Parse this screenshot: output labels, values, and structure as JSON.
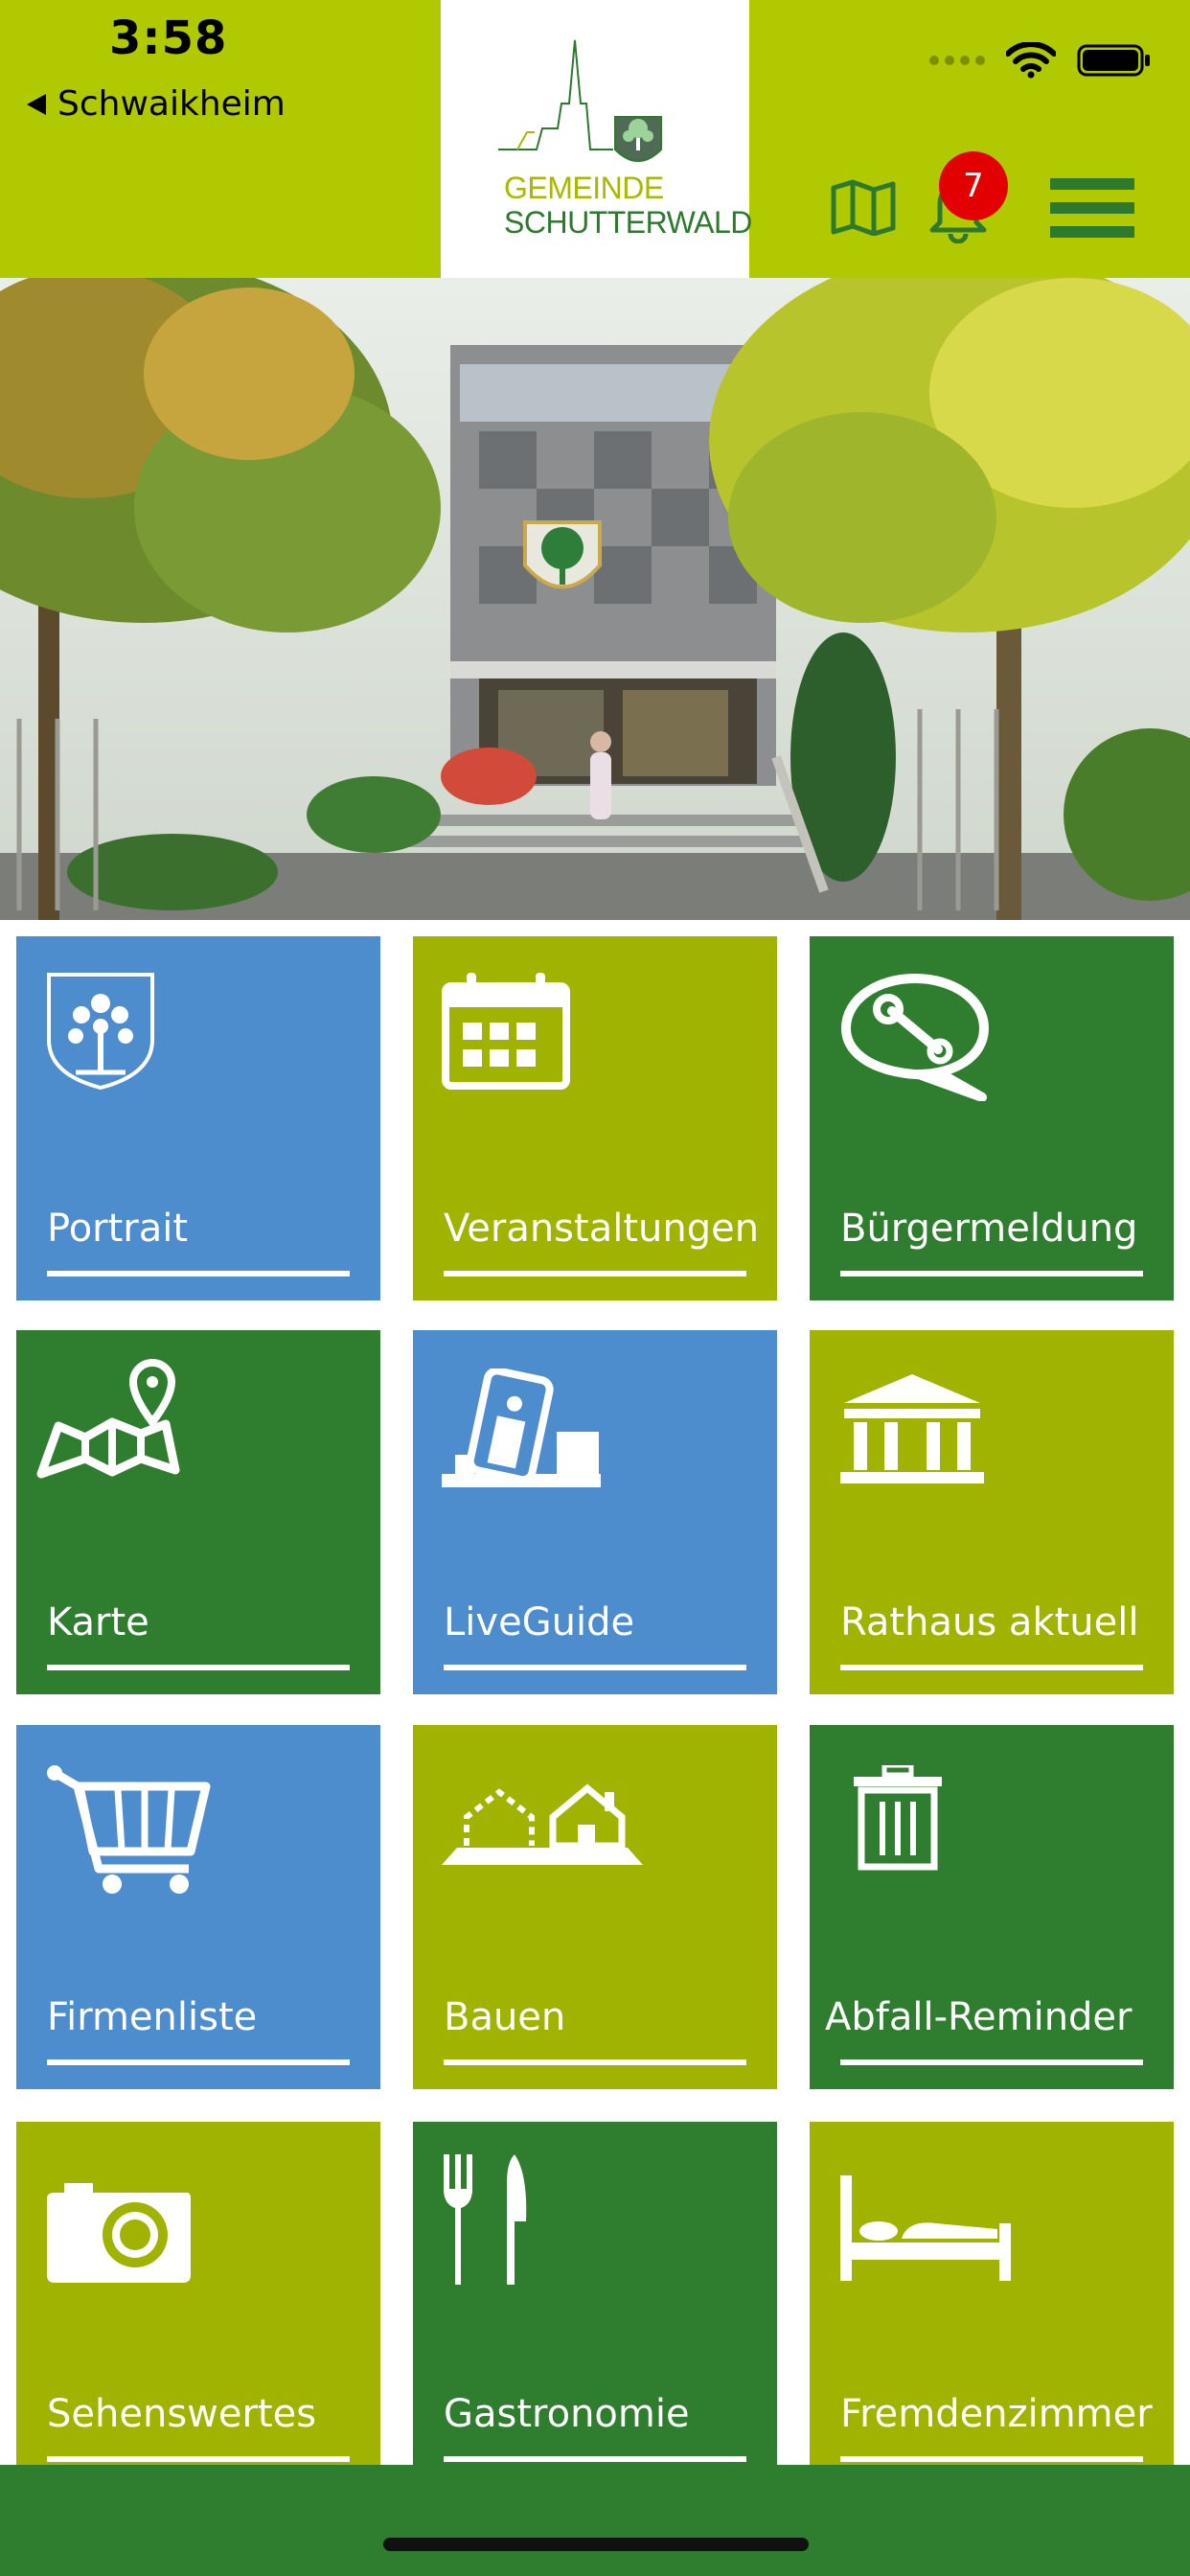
{
  "status_bar": {
    "time": "3:58",
    "back_label": "Schwaikheim"
  },
  "header": {
    "logo_line1": "GEMEINDE",
    "logo_line2": "SCHUTTERWALD",
    "notification_count": "7",
    "colors": {
      "background": "#b1c900",
      "accent_green": "#2d7a2e",
      "badge": "#e30000"
    },
    "icons": [
      "map-icon",
      "bell-icon",
      "hamburger-menu-icon"
    ]
  },
  "tiles": [
    {
      "label": "Portrait",
      "icon": "coat-of-arms-icon",
      "color": "#4d8ccd"
    },
    {
      "label": "Veranstaltungen",
      "icon": "calendar-icon",
      "color": "#a0b300"
    },
    {
      "label": "Bürgermeldung",
      "icon": "wrench-speech-bubble-icon",
      "color": "#2f7e2f"
    },
    {
      "label": "Karte",
      "icon": "map-pin-icon",
      "color": "#2f7e2f"
    },
    {
      "label": "LiveGuide",
      "icon": "phone-guide-icon",
      "color": "#4d8ccd"
    },
    {
      "label": "Rathaus aktuell",
      "icon": "town-hall-icon",
      "color": "#a0b300"
    },
    {
      "label": "Firmenliste",
      "icon": "shopping-cart-icon",
      "color": "#4d8ccd"
    },
    {
      "label": "Bauen",
      "icon": "houses-icon",
      "color": "#a0b300"
    },
    {
      "label": "Abfall-Reminder",
      "icon": "trash-can-icon",
      "color": "#2f7e2f"
    },
    {
      "label": "Sehenswertes",
      "icon": "camera-icon",
      "color": "#a0b300"
    },
    {
      "label": "Gastronomie",
      "icon": "fork-knife-icon",
      "color": "#2f7e2f"
    },
    {
      "label": "Fremdenzimmer",
      "icon": "bed-icon",
      "color": "#a0b300"
    }
  ]
}
